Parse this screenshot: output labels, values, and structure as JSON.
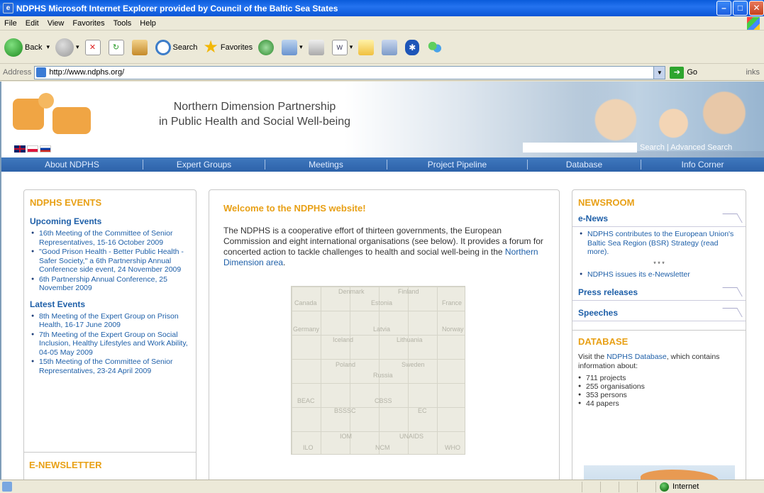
{
  "window": {
    "title": "NDPHS   Microsoft Internet Explorer provided by Council of the Baltic Sea States"
  },
  "menu": [
    "File",
    "Edit",
    "View",
    "Favorites",
    "Tools",
    "Help"
  ],
  "toolbar": {
    "back": "Back",
    "search": "Search",
    "favorites": "Favorites"
  },
  "address": {
    "label": "Address",
    "url": "http://www.ndphs.org/",
    "go": "Go",
    "links": "inks"
  },
  "banner": {
    "title_line1": "Northern Dimension Partnership",
    "title_line2": "in Public Health and Social Well-being",
    "search": "Search",
    "advanced_search": "Advanced Search",
    "separator": " | "
  },
  "nav": [
    "About NDPHS",
    "Expert Groups",
    "Meetings",
    "Project Pipeline",
    "Database",
    "Info Corner"
  ],
  "left": {
    "title": "NDPHS EVENTS",
    "upcoming_title": "Upcoming Events",
    "upcoming": [
      "16th Meeting of the Committee of Senior Representatives, 15-16 October 2009",
      "\"Good Prison Health - Better Public Health - Safer Society,\" a 6th Partnership Annual Conference side event, 24 November 2009",
      "6th Partnership Annual Conference, 25 November 2009"
    ],
    "latest_title": "Latest Events",
    "latest": [
      "8th Meeting of the Expert Group on Prison Health, 16-17 June 2009",
      "7th Meeting of the Expert Group on Social Inclusion, Healthy Lifestyles and Work Ability, 04-05 May 2009",
      "15th Meeting of the Committee of Senior Representatives, 23-24 April 2009"
    ],
    "enewsletter_title": "E-NEWSLETTER"
  },
  "center": {
    "welcome": "Welcome to the NDPHS website!",
    "intro_part1": "The NDPHS is a cooperative effort of thirteen governments, the European Commission and eight international organisations (see below). It provides a forum for concerted action to tackle challenges to health and social well-being in the ",
    "intro_link": "Northern Dimension area",
    "intro_part2": ".",
    "puzzle_labels": [
      "Canada",
      "Denmark",
      "Estonia",
      "Finland",
      "France",
      "Germany",
      "Iceland",
      "Latvia",
      "Lithuania",
      "Norway",
      "Poland",
      "Russia",
      "Sweden",
      "BEAC",
      "BSSSC",
      "CBSS",
      "EC",
      "ILO",
      "IOM",
      "NCM",
      "UNAIDS",
      "WHO"
    ]
  },
  "right": {
    "newsroom_title": "NEWSROOM",
    "enews_title": "e-News",
    "news_item1": "NDPHS contributes to the European Union's Baltic Sea Region (BSR) Strategy (read more).",
    "news_sep": "* * *",
    "news_item2": "NDPHS issues its e-Newsletter",
    "press_title": "Press releases",
    "speeches_title": "Speeches",
    "database_title": "DATABASE",
    "db_text_part1": "Visit the ",
    "db_link": "NDPHS Database",
    "db_text_part2": ", which contains information about:",
    "db_items": [
      "711 projects",
      "255 organisations",
      "353 persons",
      "44 papers"
    ]
  },
  "status": {
    "zone": "Internet"
  },
  "colors": {
    "accent_orange": "#e8a016",
    "link_blue": "#1e5fa8",
    "nav_blue": "#2d62a9"
  }
}
